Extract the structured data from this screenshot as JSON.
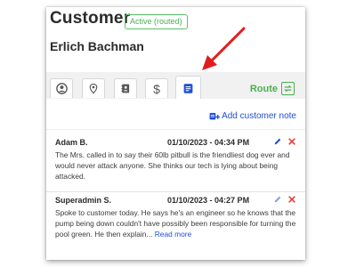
{
  "header": {
    "title": "Customer",
    "status_badge": "Active (routed)",
    "customer_name": "Erlich Bachman"
  },
  "tabs": [
    {
      "icon": "user-circle-icon",
      "active": false
    },
    {
      "icon": "location-pin-icon",
      "active": false
    },
    {
      "icon": "contact-book-icon",
      "active": false
    },
    {
      "icon": "dollar-icon",
      "active": false
    },
    {
      "icon": "notes-icon",
      "active": true
    }
  ],
  "route": {
    "label": "Route",
    "icon": "route-swap-icon"
  },
  "notes_section": {
    "add_note_label": "Add customer note",
    "add_note_icon": "add-note-icon"
  },
  "notes": [
    {
      "author": "Adam B.",
      "date": "01/10/2023 - 04:34 PM",
      "text": "The Mrs. called in to say their 60lb pitbull is the friendliest dog ever and would never attack anyone. She thinks our tech is lying about being attacked.",
      "read_more": ""
    },
    {
      "author": "Superadmin S.",
      "date": "01/10/2023 - 04:27 PM",
      "text": "Spoke to customer today. He says he's an engineer so he knows that the pump being down couldn't have possibly been responsible for turning the pool green. He then explain...",
      "read_more": "Read more"
    }
  ],
  "colors": {
    "accent_green": "#4caf50",
    "accent_blue": "#1e4fd6",
    "delete_red": "#e53935",
    "annotation_red": "#e11d1d",
    "tabbar_bg": "#f1f1f1"
  }
}
